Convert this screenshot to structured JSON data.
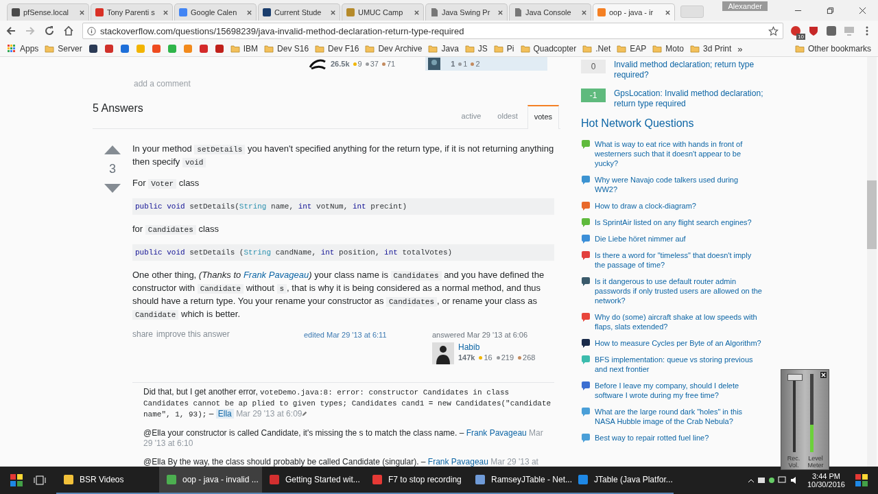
{
  "browser": {
    "profile": "Alexander",
    "tabs": [
      {
        "title": "pfSense.local",
        "kind": "site",
        "color": "#4a4a4a",
        "selected": false
      },
      {
        "title": "Tony Parenti s",
        "kind": "site",
        "color": "#d93025",
        "selected": false
      },
      {
        "title": "Google Calen",
        "kind": "site",
        "color": "#4285f4",
        "selected": false
      },
      {
        "title": "Current Stude",
        "kind": "site",
        "color": "#1a3d6d",
        "selected": false
      },
      {
        "title": "UMUC Camp",
        "kind": "site",
        "color": "#b58a2a",
        "selected": false
      },
      {
        "title": "Java Swing Pr",
        "kind": "page",
        "color": "#777777",
        "selected": false
      },
      {
        "title": "Java Console",
        "kind": "page",
        "color": "#777777",
        "selected": false
      },
      {
        "title": "oop - java - ir",
        "kind": "site",
        "color": "#f48024",
        "selected": true
      }
    ],
    "url": "stackoverflow.com/questions/15698239/java-invalid-method-declaration-return-type-required",
    "extension_badge": "10",
    "bookmarks": [
      {
        "kind": "apps",
        "label": "Apps"
      },
      {
        "kind": "folder",
        "label": "Server"
      },
      {
        "kind": "site",
        "color": "#2b3a55"
      },
      {
        "kind": "site",
        "color": "#d0302a"
      },
      {
        "kind": "site",
        "color": "#1e6fd9"
      },
      {
        "kind": "site",
        "color": "#f2b400"
      },
      {
        "kind": "site",
        "color": "#ee4b1f"
      },
      {
        "kind": "site",
        "color": "#2fb54a"
      },
      {
        "kind": "site",
        "color": "#f28a1c"
      },
      {
        "kind": "site",
        "color": "#d42a2a"
      },
      {
        "kind": "site",
        "color": "#c0201a"
      },
      {
        "kind": "folder",
        "label": "IBM"
      },
      {
        "kind": "folder",
        "label": "Dev S16"
      },
      {
        "kind": "folder",
        "label": "Dev F16"
      },
      {
        "kind": "folder",
        "label": "Dev Archive"
      },
      {
        "kind": "folder",
        "label": "Java"
      },
      {
        "kind": "folder",
        "label": "JS"
      },
      {
        "kind": "folder",
        "label": "Pi"
      },
      {
        "kind": "folder",
        "label": "Quadcopter"
      },
      {
        "kind": "folder",
        "label": ".Net"
      },
      {
        "kind": "folder",
        "label": "EAP"
      },
      {
        "kind": "folder",
        "label": "Moto"
      },
      {
        "kind": "folder",
        "label": "3d Print"
      }
    ],
    "more": "»",
    "other_bookmarks": "Other bookmarks"
  },
  "question_cards": [
    {
      "rep": "26.5k",
      "badges": [
        {
          "kind": "gold",
          "count": "9"
        },
        {
          "kind": "silver",
          "count": "37"
        },
        {
          "kind": "bronze",
          "count": "71"
        }
      ],
      "owner": false
    },
    {
      "rep": "1",
      "badges": [
        {
          "kind": "silver",
          "count": "1"
        },
        {
          "kind": "bronze",
          "count": "2"
        }
      ],
      "owner": true
    }
  ],
  "add_comment": "add a comment",
  "answers_header": {
    "title": "5 Answers",
    "sort_tabs": [
      {
        "label": "active",
        "selected": false
      },
      {
        "label": "oldest",
        "selected": false
      },
      {
        "label": "votes",
        "selected": true
      }
    ]
  },
  "answer": {
    "votes": "3",
    "body": [
      {
        "kind": "para",
        "segments": [
          {
            "kind": "text",
            "t": "In your method "
          },
          {
            "kind": "code",
            "t": "setDetails"
          },
          {
            "kind": "text",
            "t": " you haven't specified anything for the return type, if it is not returning anything then specify "
          },
          {
            "kind": "code",
            "t": "void"
          }
        ]
      },
      {
        "kind": "para",
        "segments": [
          {
            "kind": "text",
            "t": "For "
          },
          {
            "kind": "code",
            "t": "Voter"
          },
          {
            "kind": "text",
            "t": " class"
          }
        ]
      },
      {
        "kind": "code",
        "tokens": [
          {
            "kind": "kw",
            "t": "public void "
          },
          {
            "kind": "plain",
            "t": "setDetails("
          },
          {
            "kind": "type",
            "t": "String"
          },
          {
            "kind": "plain",
            "t": " name, "
          },
          {
            "kind": "kw",
            "t": "int"
          },
          {
            "kind": "plain",
            "t": " votNum, "
          },
          {
            "kind": "kw",
            "t": "int"
          },
          {
            "kind": "plain",
            "t": " precint)"
          }
        ]
      },
      {
        "kind": "para",
        "segments": [
          {
            "kind": "text",
            "t": "for "
          },
          {
            "kind": "code",
            "t": "Candidates"
          },
          {
            "kind": "text",
            "t": " class"
          }
        ]
      },
      {
        "kind": "code",
        "tokens": [
          {
            "kind": "kw",
            "t": "public void "
          },
          {
            "kind": "plain",
            "t": "setDetails ("
          },
          {
            "kind": "type",
            "t": "String"
          },
          {
            "kind": "plain",
            "t": " candName, "
          },
          {
            "kind": "kw",
            "t": "int"
          },
          {
            "kind": "plain",
            "t": " position, "
          },
          {
            "kind": "kw",
            "t": "int"
          },
          {
            "kind": "plain",
            "t": " totalVotes)"
          }
        ]
      },
      {
        "kind": "para",
        "segments": [
          {
            "kind": "text",
            "t": "One other thing, "
          },
          {
            "kind": "italic",
            "t": "(Thanks to "
          },
          {
            "kind": "link",
            "t": "Frank Pavageau"
          },
          {
            "kind": "italic",
            "t": ")"
          },
          {
            "kind": "text",
            "t": " your class name is "
          },
          {
            "kind": "code",
            "t": "Candidates"
          },
          {
            "kind": "text",
            "t": " and you have defined the constructor with "
          },
          {
            "kind": "code",
            "t": "Candidate"
          },
          {
            "kind": "text",
            "t": " without "
          },
          {
            "kind": "code",
            "t": "s"
          },
          {
            "kind": "text",
            "t": ", that is why it is being considered as a normal method, and thus should have a return type. You your rename your constructor as "
          },
          {
            "kind": "code",
            "t": "Candidates"
          },
          {
            "kind": "text",
            "t": ", or rename your class as "
          },
          {
            "kind": "code",
            "t": "Candidate"
          },
          {
            "kind": "text",
            "t": " which is better."
          }
        ]
      }
    ],
    "share": "share",
    "improve": "improve this answer",
    "edited": "edited Mar 29 '13 at 6:11",
    "answered": "answered Mar 29 '13 at 6:06",
    "user": {
      "name": "Habib",
      "rep": "147k",
      "badges": [
        {
          "kind": "gold",
          "count": "16"
        },
        {
          "kind": "silver",
          "count": "219"
        },
        {
          "kind": "bronze",
          "count": "268"
        }
      ]
    },
    "comments": [
      {
        "segments": [
          {
            "kind": "text",
            "t": "Did that, but I get another error, "
          },
          {
            "kind": "code",
            "t": "voteDemo.java:8: error: constructor Candidates in class Candidates cannot be ap plied to given types; Candidates cand1 = new Candidates(\"candidate name\", 1, 93);"
          },
          {
            "kind": "text",
            "t": " – "
          }
        ],
        "user": "Ella",
        "user_is_op": true,
        "date": "Mar 29 '13 at 6:09",
        "edited": true
      },
      {
        "segments": [
          {
            "kind": "text",
            "t": "@Ella your constructor is called Candidate, it's missing the s to match the class name. – "
          }
        ],
        "user": "Frank Pavageau",
        "user_is_op": false,
        "date": "Mar 29 '13 at 6:10",
        "edited": false
      },
      {
        "segments": [
          {
            "kind": "text",
            "t": "@Ella By the way, the class should probably be called Candidate (singular). – "
          }
        ],
        "user": "Frank Pavageau",
        "user_is_op": false,
        "date": "Mar 29 '13 at",
        "edited": false
      }
    ]
  },
  "sidebar": {
    "related": [
      {
        "score": "0",
        "title": "Invalid method declaration; return type required?",
        "accepted": false
      },
      {
        "score": "-1",
        "title": "GpsLocation: Invalid method declaration; return type required",
        "accepted": true
      }
    ],
    "hot_title": "Hot Network Questions",
    "hot": [
      {
        "title": "What is way to eat rice with hands in front of westerners such that it doesn't appear to be yucky?",
        "color": "#5fba3d"
      },
      {
        "title": "Why were Navajo code talkers used during WW2?",
        "color": "#3c93d1"
      },
      {
        "title": "How to draw a clock-diagram?",
        "color": "#e8692a"
      },
      {
        "title": "Is SprintAir listed on any flight search engines?",
        "color": "#5fba3d"
      },
      {
        "title": "Die Liebe höret nimmer auf",
        "color": "#3c8fd8"
      },
      {
        "title": "Is there a word for \"timeless\" that doesn't imply the passage of time?",
        "color": "#e2403d"
      },
      {
        "title": "Is it dangerous to use default router admin passwords if only trusted users are allowed on the network?",
        "color": "#3a5a6b"
      },
      {
        "title": "Why do (some) aircraft shake at low speeds with flaps, slats extended?",
        "color": "#e8463b"
      },
      {
        "title": "How to measure Cycles per Byte of an Algorithm?",
        "color": "#1a2b4a"
      },
      {
        "title": "BFS implementation: queue vs storing previous and next frontier",
        "color": "#3cbcad"
      },
      {
        "title": "Before I leave my company, should I delete software I wrote during my free time?",
        "color": "#3c6fd1"
      },
      {
        "title": "What are the large round dark \"holes\" in this NASA Hubble image of the Crab Nebula?",
        "color": "#4a9fd8"
      },
      {
        "title": "Best way to repair rotted fuel line?",
        "color": "#4a9fd8"
      }
    ]
  },
  "recorder": {
    "volume": {
      "label": "Rec. Vol.",
      "level": 1.0
    },
    "meter": {
      "label": "Level Meter",
      "level": 0.35
    }
  },
  "taskbar": {
    "items": [
      {
        "label": "BSR Videos",
        "color": "#f2c13a",
        "selected": false
      },
      {
        "label": "oop - java - invalid ...",
        "color": "#4caf50",
        "selected": true
      },
      {
        "label": "Getting Started wit...",
        "color": "#d32f2f",
        "selected": false
      },
      {
        "label": "F7 to stop recording",
        "color": "#e53935",
        "selected": false
      },
      {
        "label": "RamseyJTable - Net...",
        "color": "#6f9bd8",
        "selected": false
      },
      {
        "label": "JTable (Java Platfor...",
        "color": "#1e88e5",
        "selected": false
      }
    ],
    "time": "3:44 PM",
    "date": "10/30/2016"
  }
}
